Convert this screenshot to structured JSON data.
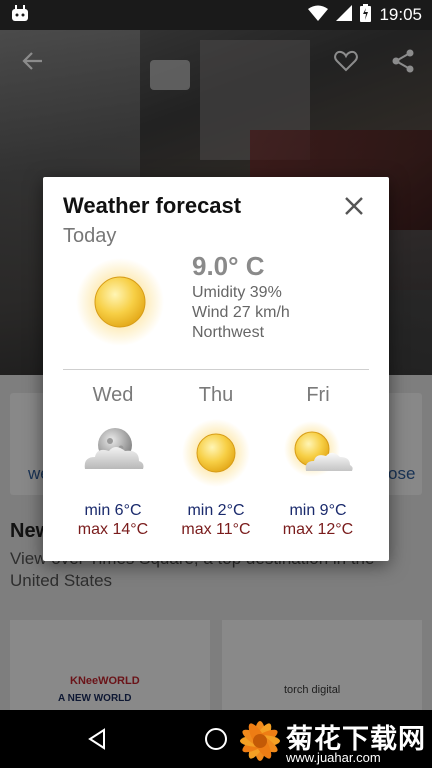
{
  "status_bar": {
    "time": "19:05",
    "icons": [
      "android-icon",
      "wifi-icon",
      "signal-icon",
      "battery-icon"
    ]
  },
  "background_app": {
    "toolbar": {
      "back_icon": "arrow-left-icon",
      "favorite_icon": "heart-icon",
      "share_icon": "share-icon"
    },
    "actions_partial": {
      "left_label": "we",
      "right_label": "ose"
    },
    "news": {
      "title": "New",
      "description": "View over Times Square, a top destination in the United States"
    },
    "tiles": [
      {
        "logo_line1": "KNeeWORLD",
        "logo_line2": "A NEW WORLD"
      },
      {
        "logo": "torch digital"
      }
    ]
  },
  "dialog": {
    "title": "Weather forecast",
    "close_icon": "close-icon",
    "today_label": "Today",
    "current": {
      "temperature": "9.0° C",
      "humidity": "Umidity 39%",
      "wind": "Wind 27 km/h",
      "direction": "Northwest",
      "icon": "sun-icon"
    },
    "forecast": [
      {
        "day": "Wed",
        "icon": "cloudy-night-icon",
        "min": "min 6°C",
        "max": "max 14°C"
      },
      {
        "day": "Thu",
        "icon": "sun-icon",
        "min": "min 2°C",
        "max": "max 11°C"
      },
      {
        "day": "Fri",
        "icon": "partly-cloudy-icon",
        "min": "min 9°C",
        "max": "max 12°C"
      }
    ]
  },
  "nav_bar": {
    "back": "nav-back-icon",
    "home": "nav-home-icon",
    "recents": "nav-recents-icon"
  },
  "watermark": {
    "text": "菊花下载网",
    "url": "www.juahar.com"
  },
  "colors": {
    "min_temp": "#1a2a6c",
    "max_temp": "#7a1c1c",
    "sun": "#f5c242"
  }
}
